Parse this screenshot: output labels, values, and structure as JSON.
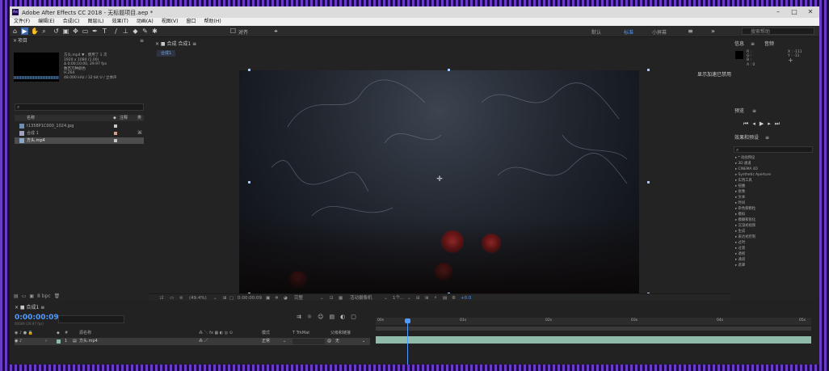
{
  "window": {
    "title": "Adobe After Effects CC 2018 - 无标题项目.aep *",
    "app_icon": "Ae"
  },
  "menus": [
    "文件(F)",
    "编辑(E)",
    "合成(C)",
    "图层(L)",
    "效果(T)",
    "动画(A)",
    "视图(V)",
    "窗口",
    "帮助(H)"
  ],
  "toolbar": {
    "align_label": "对齐",
    "workspaces": [
      "默认",
      "标准",
      "小屏幕"
    ],
    "selected_workspace": "标准",
    "search_placeholder": "搜索帮助"
  },
  "project_panel": {
    "title": "项目",
    "meta": [
      "方头.mp4 ▼ , 使用了 1 次",
      "1920 x 1080 (1.00)",
      "Δ 0;00;10;00, 29.97 fps",
      "数百万种颜色",
      "H.264",
      "48.000 kHz / 32 bit U / 立体声"
    ],
    "search_icon": "⌕",
    "columns": {
      "name": "名称",
      "comment": "注释",
      "type": "类"
    },
    "items": [
      {
        "name": "t1358P1C000_1024.jpg",
        "color": "#c8c8c8"
      },
      {
        "name": "合成 1",
        "color": "#d8a08a"
      },
      {
        "name": "方头.mp4",
        "color": "#c8c8c8"
      }
    ],
    "footer": [
      "8 bpc"
    ]
  },
  "composition_panel": {
    "tab": "合成 合成1",
    "sub_tab": "合成1",
    "gpu_notice": "显示加速已禁用",
    "footer": {
      "zoom": "(49.4%)",
      "timecode": "0:00:00:09",
      "resolution": "完整",
      "camera": "活动摄像机",
      "views": "1个...",
      "exposure": "+0.0"
    }
  },
  "right_panel": {
    "info_tab": "信息",
    "audio_tab": "音频",
    "rgba": [
      "R :",
      "G :",
      "B :",
      "A : 0"
    ],
    "xy": [
      "X : -111",
      "Y : -11"
    ],
    "preview_tab": "预览",
    "effects_tab": "效果和预设",
    "effects": [
      "* 动画预设",
      "3D 通道",
      "CINEMA 4D",
      "Synthetic Aperture",
      "实用工具",
      "扭曲",
      "抠像",
      "文本",
      "时间",
      "杂色和颗粒",
      "模拟",
      "模糊和锐化",
      "沉浸式视频",
      "生成",
      "表达式控制",
      "过时",
      "过渡",
      "透视",
      "通道",
      "遮罩"
    ]
  },
  "timeline": {
    "tab": "合成1",
    "timecode": "0:00:00:09",
    "frames": "00009 (29.97 fps)",
    "headers": {
      "source_name": "源名称",
      "mode": "模式",
      "trkmat": "T TrkMat",
      "parent": "父级和链接"
    },
    "layer": {
      "index": "1",
      "name": "方头.mp4",
      "mode": "正常",
      "parent": "无"
    },
    "ruler": [
      "00s",
      "01s",
      "02s",
      "03s",
      "04s",
      "05s"
    ]
  }
}
